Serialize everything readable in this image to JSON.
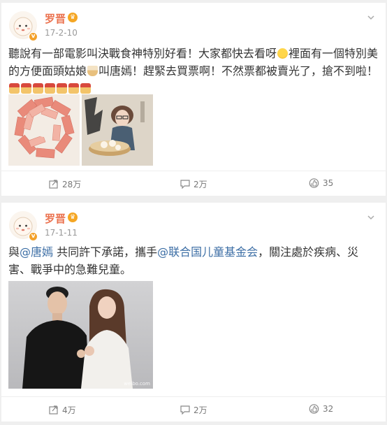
{
  "posts": [
    {
      "author": "罗晋",
      "date": "17-2-10",
      "text_a": "聽說有一部電影叫決戰食神特別好看！大家都快去看呀",
      "text_b": "裡面有一個特別美的方便面頭姑娘",
      "text_c": "叫唐嫣！趕緊去買票啊！不然票都被賣光了，搶不到啦！",
      "actions": {
        "repost": "28万",
        "comment": "2万",
        "like": "35"
      }
    },
    {
      "author": "罗晋",
      "date": "17-1-11",
      "text_a": "與",
      "mention_a": "@唐嫣",
      "text_b": " 共同許下承諾，攜手",
      "mention_b": "@联合国儿童基金会",
      "text_c": "，關注處於疾病、災害、戰爭中的急難兒童。",
      "image_watermark": "weibo.com",
      "actions": {
        "repost": "4万",
        "comment": "2万",
        "like": "32"
      }
    }
  ],
  "colors": {
    "username": "#eb7350",
    "mention": "#3c6ea5",
    "meta": "#999999",
    "background": "#efefef"
  },
  "icons": [
    "avatar",
    "verified-badge",
    "crown-badge",
    "chevron-down-icon",
    "smiley-emoji",
    "noodle-emoji",
    "house-emoji",
    "repost-icon",
    "comment-icon",
    "like-icon"
  ]
}
